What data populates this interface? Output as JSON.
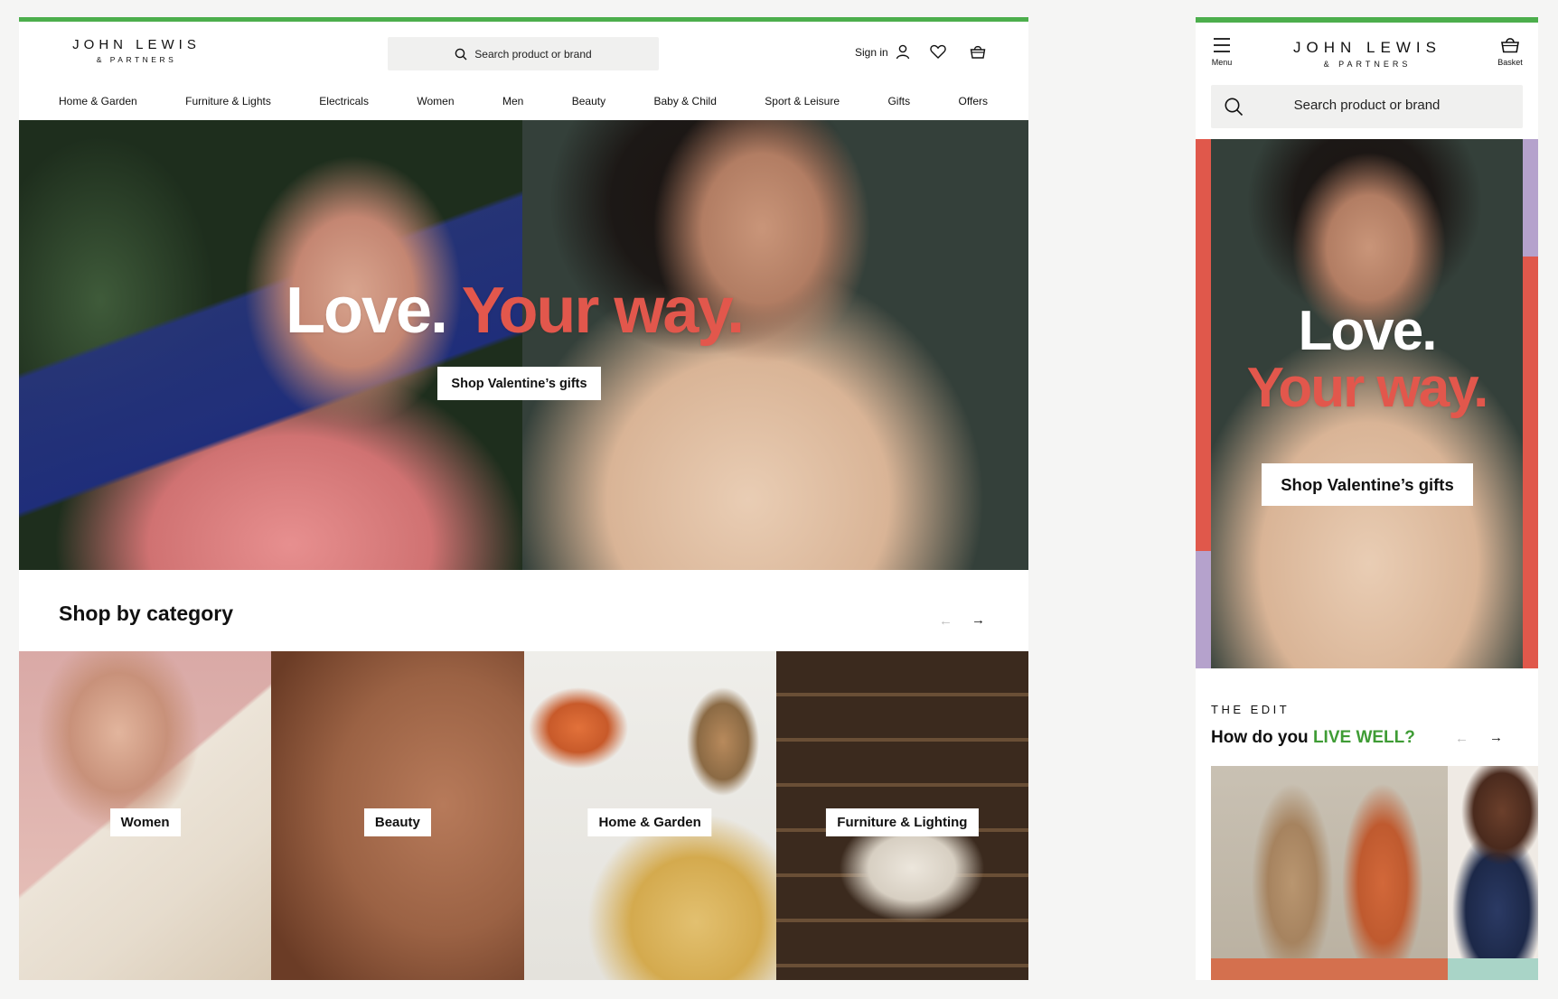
{
  "colors": {
    "accent_green": "#4cae4c",
    "hero_red": "#e2574c",
    "live_well_green": "#3f9c35",
    "mobile_red_bar": "#e0584b",
    "mobile_purple_bar": "#b5a2cc"
  },
  "desktop": {
    "logo": {
      "line1": "JOHN LEWIS",
      "line2": "& PARTNERS"
    },
    "search": {
      "placeholder": "Search product or brand",
      "icon": "search-icon"
    },
    "header": {
      "signin_label": "Sign in",
      "icons": [
        "user-icon",
        "heart-icon",
        "basket-icon"
      ]
    },
    "nav": [
      {
        "label": "Home & Garden"
      },
      {
        "label": "Furniture & Lights"
      },
      {
        "label": "Electricals"
      },
      {
        "label": "Women"
      },
      {
        "label": "Men"
      },
      {
        "label": "Beauty"
      },
      {
        "label": "Baby & Child"
      },
      {
        "label": "Sport & Leisure"
      },
      {
        "label": "Gifts"
      },
      {
        "label": "Offers"
      }
    ],
    "hero": {
      "title_white": "Love.",
      "title_red": "Your way.",
      "cta": "Shop Valentine’s gifts"
    },
    "shop_by_category": {
      "title": "Shop by category",
      "prev_arrow": "←",
      "next_arrow": "→",
      "tiles": [
        {
          "label": "Women"
        },
        {
          "label": "Beauty"
        },
        {
          "label": "Home & Garden"
        },
        {
          "label": "Furniture & Lighting"
        }
      ]
    }
  },
  "mobile": {
    "menu_label": "Menu",
    "basket_label": "Basket",
    "logo": {
      "line1": "JOHN LEWIS",
      "line2": "& PARTNERS"
    },
    "search": {
      "placeholder": "Search product or brand"
    },
    "hero": {
      "title_white": "Love.",
      "title_red": "Your way.",
      "cta": "Shop Valentine’s gifts"
    },
    "edit": {
      "kicker": "THE EDIT",
      "title_prefix": "How do you ",
      "title_accent": "LIVE WELL?",
      "prev_arrow": "←",
      "next_arrow": "→"
    }
  }
}
